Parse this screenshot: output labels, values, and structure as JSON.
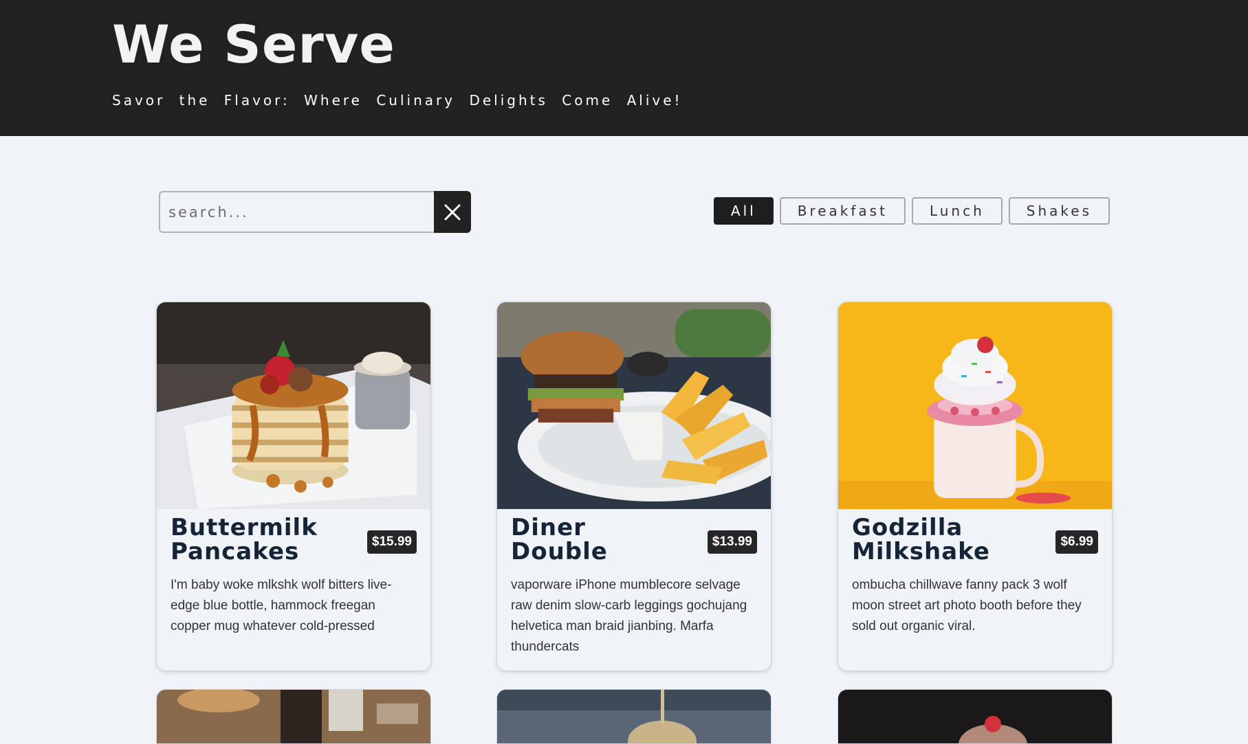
{
  "header": {
    "brand": "We Serve",
    "tagline": "Savor the Flavor: Where Culinary Delights Come Alive!"
  },
  "search": {
    "placeholder": "search...",
    "value": "",
    "clear_icon": "close-icon"
  },
  "filters": [
    {
      "label": "All",
      "active": true
    },
    {
      "label": "Breakfast",
      "active": false
    },
    {
      "label": "Lunch",
      "active": false
    },
    {
      "label": "Shakes",
      "active": false
    }
  ],
  "menu": [
    {
      "title": "Buttermilk Pancakes",
      "price": "$15.99",
      "description": "I'm baby woke mlkshk wolf bitters live-edge blue bottle, hammock freegan copper mug whatever cold-pressed"
    },
    {
      "title": "Diner Double",
      "price": "$13.99",
      "description": "vaporware iPhone mumblecore selvage raw denim slow-carb leggings gochujang helvetica man braid jianbing. Marfa thundercats"
    },
    {
      "title": "Godzilla Milkshake",
      "price": "$6.99",
      "description": "ombucha chillwave fanny pack 3 wolf moon street art photo booth before they sold out organic viral."
    }
  ],
  "colors": {
    "header_bg": "#212121",
    "page_bg": "#f0f3f7",
    "title": "#152437",
    "badge": "#262626"
  }
}
